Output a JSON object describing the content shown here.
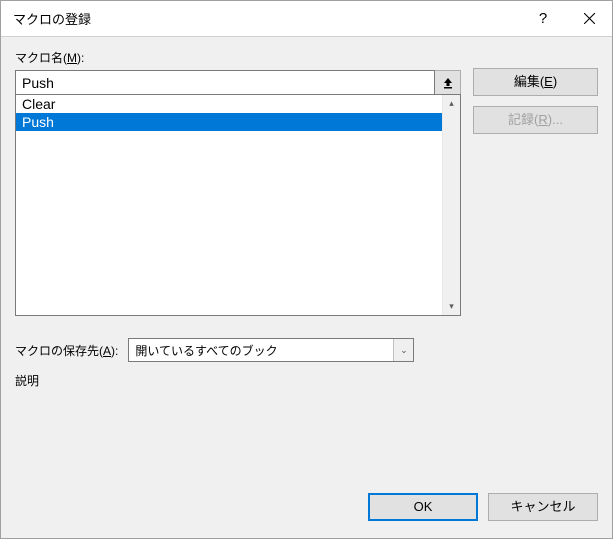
{
  "titlebar": {
    "title": "マクロの登録",
    "help": "?",
    "close": "×"
  },
  "labels": {
    "macro_name_pre": "マクロ名(",
    "macro_name_key": "M",
    "macro_name_post": "):",
    "save_loc_pre": "マクロの保存先(",
    "save_loc_key": "A",
    "save_loc_post": "):",
    "description": "説明"
  },
  "macro_name_value": "Push",
  "macro_list": [
    {
      "name": "Clear",
      "selected": false
    },
    {
      "name": "Push",
      "selected": true
    }
  ],
  "side_buttons": {
    "edit_pre": "編集(",
    "edit_key": "E",
    "edit_post": ")",
    "record_pre": "記録(",
    "record_key": "R",
    "record_post": ")..."
  },
  "save_select_value": "開いているすべてのブック",
  "footer": {
    "ok": "OK",
    "cancel": "キャンセル"
  }
}
